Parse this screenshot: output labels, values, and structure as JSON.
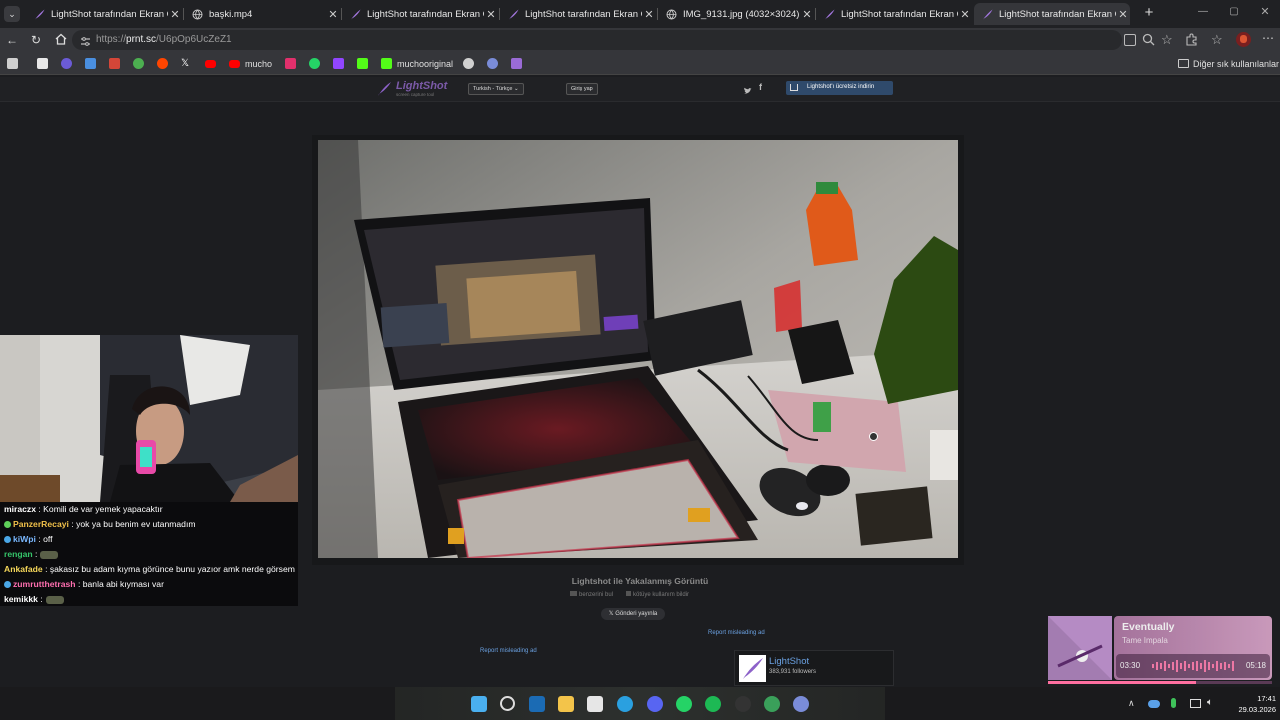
{
  "browser": {
    "tabs": [
      {
        "title": "LightShot tarafından Ekran Görünt",
        "icon": "lightshot-feather-icon",
        "active": false
      },
      {
        "title": "başki.mp4",
        "icon": "globe-icon",
        "active": false
      },
      {
        "title": "LightShot tarafından Ekran Görünt",
        "icon": "lightshot-feather-icon",
        "active": false
      },
      {
        "title": "LightShot tarafından Ekran Görünt",
        "icon": "lightshot-feather-icon",
        "active": false
      },
      {
        "title": "IMG_9131.jpg (4032×3024)",
        "icon": "globe-icon",
        "active": false
      },
      {
        "title": "LightShot tarafından Ekran Görünt",
        "icon": "lightshot-feather-icon",
        "active": false
      },
      {
        "title": "LightShot tarafından Ekran Görünt",
        "icon": "lightshot-feather-icon",
        "active": true
      }
    ],
    "new_tab": "+",
    "url_prefix": "https://",
    "url_host": "prnt.sc",
    "url_path": "/U6pOp6UcZeZ1",
    "bookmarks": [
      {
        "label": "",
        "icon": "controller-icon",
        "color": "#cfcfcf"
      },
      {
        "label": "",
        "icon": "photos-icon",
        "color": "#e8e8e8"
      },
      {
        "label": "",
        "icon": "circle-app-icon",
        "color": "#6b5bd6"
      },
      {
        "label": "",
        "icon": "files-icon",
        "color": "#4a8fe0"
      },
      {
        "label": "",
        "icon": "gmail-icon",
        "color": "#d44638"
      },
      {
        "label": "",
        "icon": "chrome-icon",
        "color": "#4caf50"
      },
      {
        "label": "",
        "icon": "reddit-icon",
        "color": "#ff4500"
      },
      {
        "label": "",
        "icon": "x-icon",
        "color": "#ffffff"
      },
      {
        "label": "",
        "icon": "youtube-icon",
        "color": "#ff0000"
      },
      {
        "label": "mucho",
        "icon": "youtube-icon",
        "color": "#ff0000"
      },
      {
        "label": "",
        "icon": "instagram-icon",
        "color": "#e1306c"
      },
      {
        "label": "",
        "icon": "whatsapp-icon",
        "color": "#25d366"
      },
      {
        "label": "",
        "icon": "twitch-icon",
        "color": "#9146ff"
      },
      {
        "label": "",
        "icon": "app-green-icon",
        "color": "#53fc18"
      },
      {
        "label": "muchooriginal",
        "icon": "kick-icon",
        "color": "#53fc18"
      },
      {
        "label": "",
        "icon": "app-icon",
        "color": "#d0d0d0"
      },
      {
        "label": "",
        "icon": "steam-icon",
        "color": "#7a8cd8"
      },
      {
        "label": "",
        "icon": "lightshot-feather-icon",
        "color": "#9a6bd6"
      }
    ],
    "other_bookmarks": "Diğer sık kullanılanlar"
  },
  "lightshot": {
    "logo_title": "LightShot",
    "logo_sub": "screen capture tool",
    "language": "Turkish - Türkçe",
    "login": "Giriş yap",
    "download": "Lightshot'ı ücretsiz indirin",
    "caption_title": "Lightshot ile Yakalanmış Görüntü",
    "find_similar": "benzerini bul",
    "report_abuse": "kötüye kullanım bildir",
    "tweet": "Gönderi yayınla",
    "report_ad_1": "Report misleading ad",
    "report_ad_2": "Report misleading ad",
    "fb_name": "LightShot",
    "fb_followers": "383,931 followers"
  },
  "chat": [
    {
      "user": "miraczx",
      "color": "#ffffff",
      "msg": ": Komili de var yemek yapacaktır"
    },
    {
      "user": "PanzerRecayi",
      "color": "#f0c04a",
      "msg": ": yok ya bu benim ev utanmadım"
    },
    {
      "user": "kiWpi",
      "color": "#7ab8ff",
      "msg": ": off"
    },
    {
      "user": "rengan",
      "color": "#35c46a",
      "msg": ":"
    },
    {
      "user": "Ankafade",
      "color": "#f5d75a",
      "msg": ": şakasız bu adam kıyma görünce bunu yazıor amk nerde görsem"
    },
    {
      "user": "zumrutthetrash",
      "color": "#ff6fb0",
      "msg": ": banla abi kıyması var"
    },
    {
      "user": "kemikkk",
      "color": "#ffffff",
      "msg": ":"
    }
  ],
  "music": {
    "title": "Eventually",
    "artist": "Tame Impala",
    "elapsed": "03:30",
    "total": "05:18",
    "progress": 0.66
  },
  "taskbar": {
    "time": "17:41",
    "date": "29.03.2026",
    "apps": [
      "windows-start-icon",
      "search-icon",
      "steam-icon",
      "file-explorer-icon",
      "calendar-icon",
      "edge-icon",
      "discord-icon",
      "whatsapp-icon",
      "spotify-icon",
      "github-icon",
      "app-icon",
      "app-icon-2"
    ]
  }
}
